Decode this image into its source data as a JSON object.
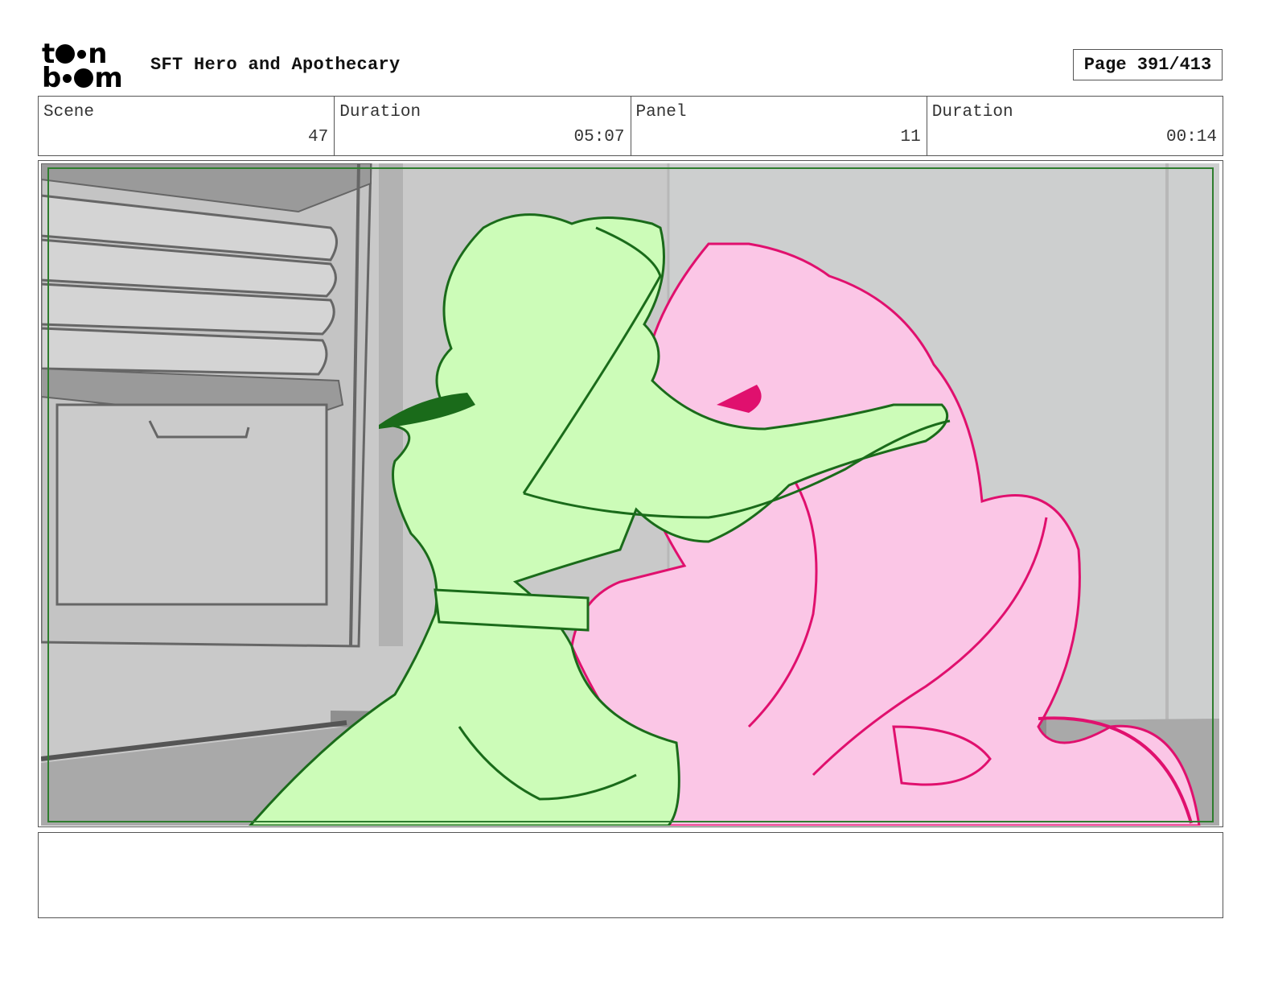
{
  "header": {
    "logo_text_top": "toon",
    "logo_text_bottom": "boom",
    "project_title": "SFT Hero and Apothecary",
    "page_label": "Page 391/413"
  },
  "info": {
    "scene_label": "Scene",
    "scene_value": "47",
    "scene_duration_label": "Duration",
    "scene_duration_value": "05:07",
    "panel_label": "Panel",
    "panel_value": "11",
    "panel_duration_label": "Duration",
    "panel_duration_value": "00:14"
  },
  "panel": {
    "background_color": "#c9c9c9",
    "character_left_color": "#ccfcb8",
    "character_left_line": "#1a6b1a",
    "character_right_color": "#fbc6e6",
    "character_right_line": "#e0106e",
    "safe_frame_color": "#2e7d2e"
  },
  "notes": {
    "text": ""
  }
}
